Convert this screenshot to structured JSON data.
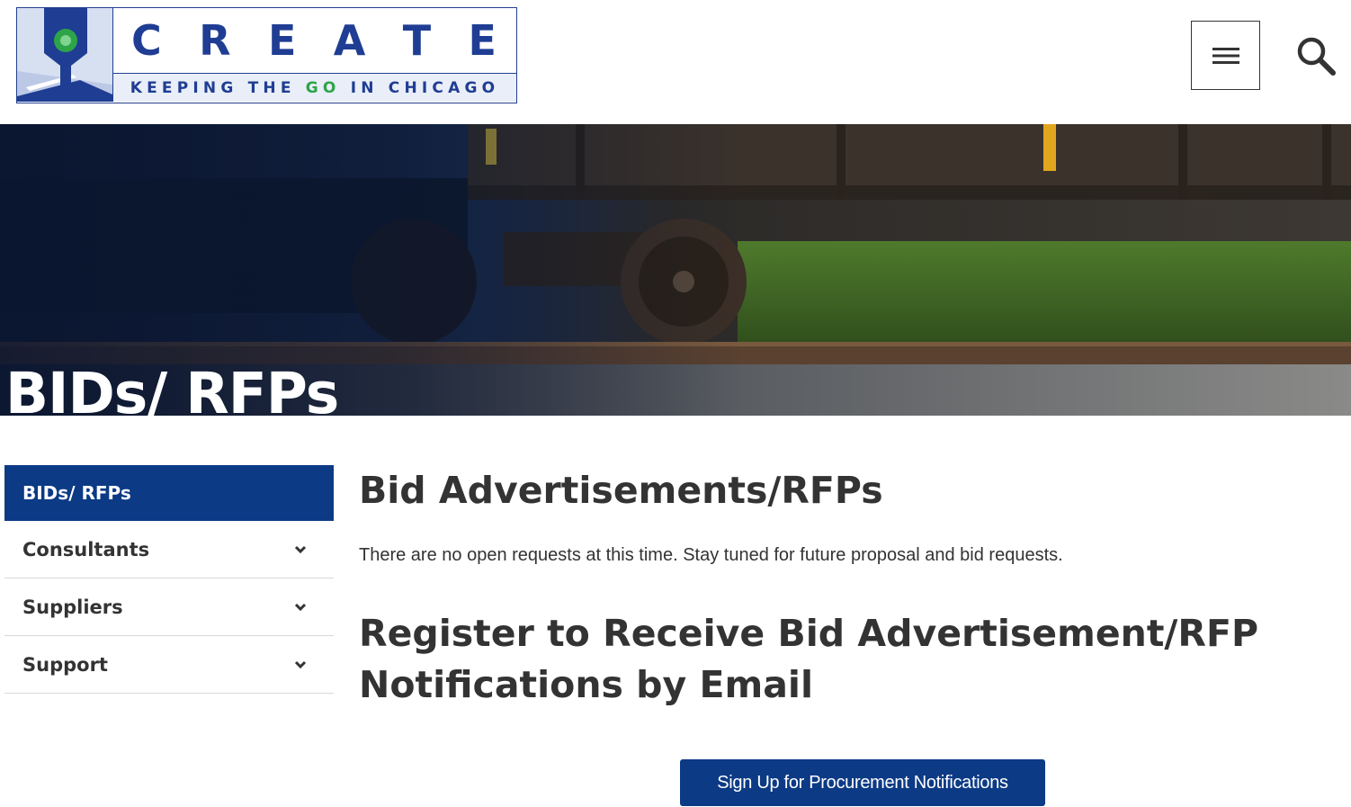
{
  "header": {
    "logo_word": [
      "C",
      "R",
      "E",
      "A",
      "T",
      "E"
    ],
    "logo_tag_before": "KEEPING THE ",
    "logo_tag_go": "GO",
    "logo_tag_after": " IN CHICAGO",
    "menu_icon": "hamburger-icon",
    "search_icon": "search-icon"
  },
  "hero": {
    "title": "BIDs/ RFPs"
  },
  "sidebar": {
    "items": [
      {
        "label": "BIDs/ RFPs",
        "active": true
      },
      {
        "label": "Consultants",
        "active": false
      },
      {
        "label": "Suppliers",
        "active": false
      },
      {
        "label": "Support",
        "active": false
      }
    ]
  },
  "main": {
    "heading": "Bid Advertisements/RFPs",
    "intro": "There are no open requests at this time. Stay tuned for future proposal and bid requests.",
    "register_heading": "Register to Receive Bid Advertisement/RFP Notifications by Email",
    "cta_label": "Sign Up for Procurement Notifications"
  },
  "colors": {
    "brand_blue": "#0c3a85",
    "logo_blue": "#1f3d93",
    "logo_green": "#2ea449",
    "text": "#333333"
  }
}
